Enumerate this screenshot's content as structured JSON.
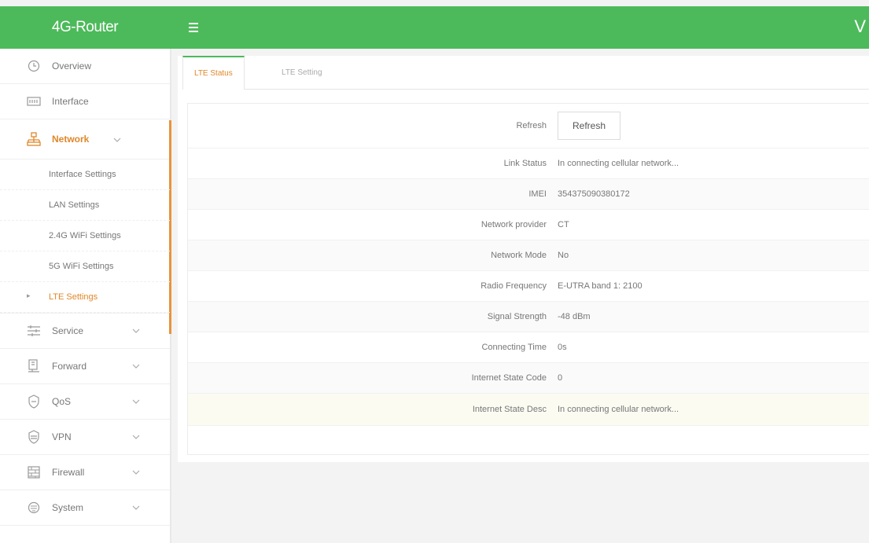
{
  "header": {
    "brand": "4G-Router",
    "menu_icon": "hamburger-icon",
    "corner_text": "V"
  },
  "colors": {
    "header": "#4cba5a",
    "accent": "#e0872a",
    "active_bar": "#e8943d"
  },
  "sidebar": {
    "items": [
      {
        "label": "Overview",
        "icon": "clock-icon"
      },
      {
        "label": "Interface",
        "icon": "interface-icon"
      },
      {
        "label": "Network",
        "icon": "network-icon"
      },
      {
        "label": "Service",
        "icon": "service-icon"
      },
      {
        "label": "Forward",
        "icon": "forward-icon"
      },
      {
        "label": "QoS",
        "icon": "qos-icon"
      },
      {
        "label": "VPN",
        "icon": "vpn-icon"
      },
      {
        "label": "Firewall",
        "icon": "firewall-icon"
      },
      {
        "label": "System",
        "icon": "system-icon"
      }
    ],
    "network_sub": [
      {
        "label": "Interface Settings"
      },
      {
        "label": "LAN Settings"
      },
      {
        "label": "2.4G WiFi Settings"
      },
      {
        "label": "5G WiFi Settings"
      },
      {
        "label": "LTE Settings"
      }
    ]
  },
  "tabs": [
    "LTE Status",
    "LTE Setting"
  ],
  "status": {
    "refresh_label": "Refresh",
    "refresh_button": "Refresh",
    "rows": [
      {
        "label": "Link Status",
        "value": "In connecting cellular network..."
      },
      {
        "label": "IMEI",
        "value": "354375090380172"
      },
      {
        "label": "Network provider",
        "value": "CT"
      },
      {
        "label": "Network Mode",
        "value": "No"
      },
      {
        "label": "Radio Frequency",
        "value": "E-UTRA band 1: 2100"
      },
      {
        "label": "Signal Strength",
        "value": "-48 dBm"
      },
      {
        "label": "Connecting Time",
        "value": "0s"
      },
      {
        "label": "Internet State Code",
        "value": "0"
      },
      {
        "label": "Internet State Desc",
        "value": "In connecting cellular network..."
      }
    ]
  }
}
